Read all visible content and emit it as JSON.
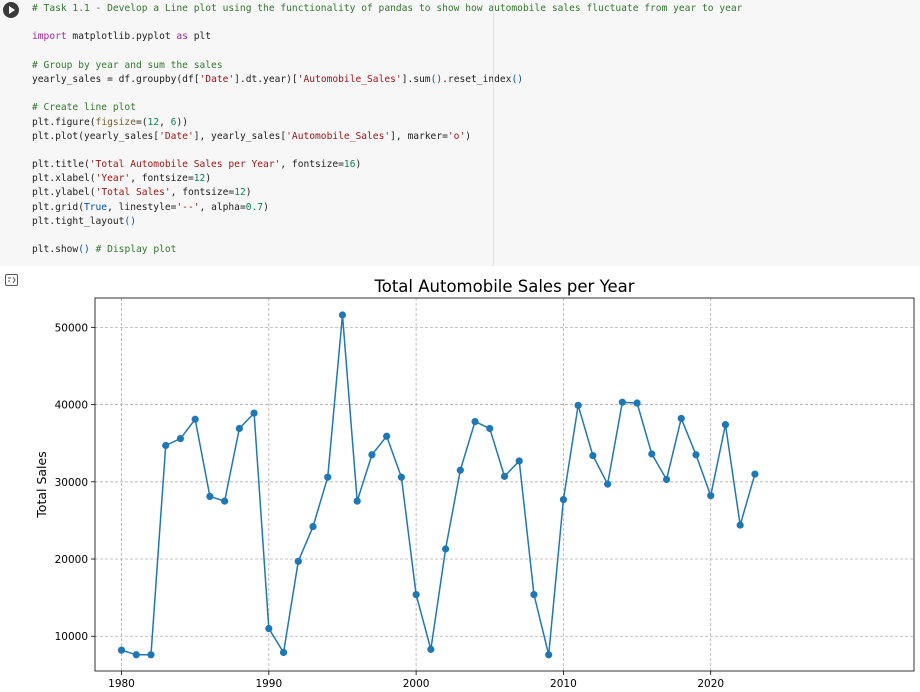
{
  "notebook": {
    "run_button_label": "Run cell",
    "code_lines": [
      [
        {
          "t": "# Task 1.1 - Develop a Line plot using the functionality of pandas to show how automobile sales fluctuate from year to year",
          "c": "com"
        }
      ],
      [],
      [
        {
          "t": "import",
          "c": "kw"
        },
        {
          "t": " matplotlib.pyplot "
        },
        {
          "t": "as",
          "c": "kw"
        },
        {
          "t": " plt"
        }
      ],
      [],
      [
        {
          "t": "# Group by year and sum the sales",
          "c": "com"
        }
      ],
      [
        {
          "t": "yearly_sales = df.groupby(df["
        },
        {
          "t": "'Date'",
          "c": "str"
        },
        {
          "t": "].dt.year)["
        },
        {
          "t": "'Automobile_Sales'",
          "c": "str"
        },
        {
          "t": "].sum"
        },
        {
          "t": "()",
          "c": "br"
        },
        {
          "t": ".reset_index"
        },
        {
          "t": "()",
          "c": "br"
        }
      ],
      [],
      [
        {
          "t": "# Create line plot",
          "c": "com"
        }
      ],
      [
        {
          "t": "plt.figure("
        },
        {
          "t": "figsize",
          "c": "fn"
        },
        {
          "t": "=("
        },
        {
          "t": "12",
          "c": "num"
        },
        {
          "t": ", "
        },
        {
          "t": "6",
          "c": "num"
        },
        {
          "t": "))"
        }
      ],
      [
        {
          "t": "plt.plot(yearly_sales["
        },
        {
          "t": "'Date'",
          "c": "str"
        },
        {
          "t": "], yearly_sales["
        },
        {
          "t": "'Automobile_Sales'",
          "c": "str"
        },
        {
          "t": "], marker="
        },
        {
          "t": "'o'",
          "c": "str"
        },
        {
          "t": ")"
        }
      ],
      [],
      [
        {
          "t": "plt.title("
        },
        {
          "t": "'Total Automobile Sales per Year'",
          "c": "str"
        },
        {
          "t": ", fontsize="
        },
        {
          "t": "16",
          "c": "num"
        },
        {
          "t": ")"
        }
      ],
      [
        {
          "t": "plt.xlabel("
        },
        {
          "t": "'Year'",
          "c": "str"
        },
        {
          "t": ", fontsize="
        },
        {
          "t": "12",
          "c": "num"
        },
        {
          "t": ")"
        }
      ],
      [
        {
          "t": "plt.ylabel("
        },
        {
          "t": "'Total Sales'",
          "c": "str"
        },
        {
          "t": ", fontsize="
        },
        {
          "t": "12",
          "c": "num"
        },
        {
          "t": ")"
        }
      ],
      [
        {
          "t": "plt.grid("
        },
        {
          "t": "True",
          "c": "br"
        },
        {
          "t": ", linestyle="
        },
        {
          "t": "'--'",
          "c": "str"
        },
        {
          "t": ", alpha="
        },
        {
          "t": "0.7",
          "c": "num"
        },
        {
          "t": ")"
        }
      ],
      [
        {
          "t": "plt.tight_layout"
        },
        {
          "t": "()",
          "c": "br"
        }
      ],
      [],
      [
        {
          "t": "plt.show"
        },
        {
          "t": "()",
          "c": "br"
        },
        {
          "t": " "
        },
        {
          "t": "# Display plot",
          "c": "com"
        }
      ]
    ],
    "output_icon": "output-toggle-icon"
  },
  "colors": {
    "line": "#1f77b4",
    "comment": "#34782f",
    "keyword": "#a626a4",
    "string": "#a31515",
    "number": "#098658"
  },
  "chart_data": {
    "type": "line",
    "title": "Total Automobile Sales per Year",
    "xlabel": "",
    "ylabel": "Total Sales",
    "xlim": [
      1978.2,
      2033.8
    ],
    "ylim": [
      5500,
      53800
    ],
    "x_ticks": [
      1980,
      1990,
      2000,
      2010,
      2020
    ],
    "y_ticks": [
      10000,
      20000,
      30000,
      40000,
      50000
    ],
    "grid": true,
    "marker": "o",
    "series": [
      {
        "x": [
          1980,
          1981,
          1982,
          1983,
          1984,
          1985,
          1986,
          1987,
          1988,
          1989,
          1990,
          1991,
          1992,
          1993,
          1994,
          1995,
          1996,
          1997,
          1998,
          1999,
          2000,
          2001,
          2002,
          2003,
          2004,
          2005,
          2006,
          2007,
          2008,
          2009,
          2010,
          2011,
          2012,
          2013,
          2014,
          2015,
          2016,
          2017,
          2018,
          2019,
          2020,
          2021,
          2022,
          2023
        ],
        "y": [
          8200,
          7600,
          7600,
          34700,
          35600,
          38100,
          28100,
          27500,
          36900,
          38900,
          11000,
          7900,
          19700,
          24200,
          30600,
          51600,
          27500,
          33500,
          35900,
          30600,
          15400,
          8300,
          21300,
          31500,
          37800,
          36900,
          30700,
          32700,
          15400,
          7600,
          27700,
          39900,
          33400,
          29700,
          40300,
          40200,
          33600,
          30300,
          38200,
          33500,
          28200,
          37400,
          24400,
          31000
        ]
      }
    ]
  }
}
